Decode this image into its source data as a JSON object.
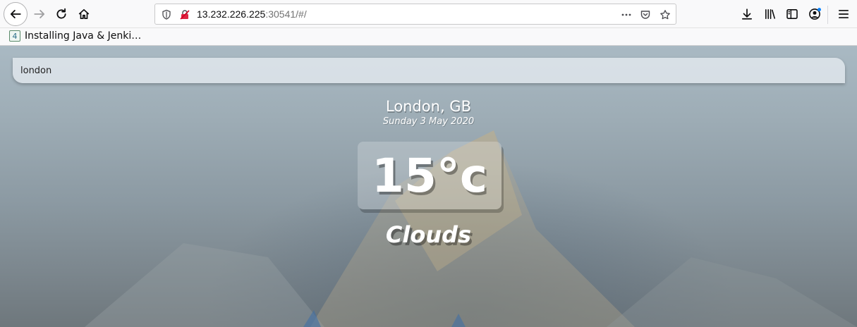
{
  "browser": {
    "url_host": "13.232.226.225",
    "url_rest": ":30541/#/",
    "bookmark_label": "Installing Java & Jenki…",
    "bookmark_favicon_char": "4"
  },
  "app": {
    "search_value": "london",
    "location": "London, GB",
    "date": "Sunday 3 May 2020",
    "temperature": "15°c",
    "weather": "Clouds"
  }
}
